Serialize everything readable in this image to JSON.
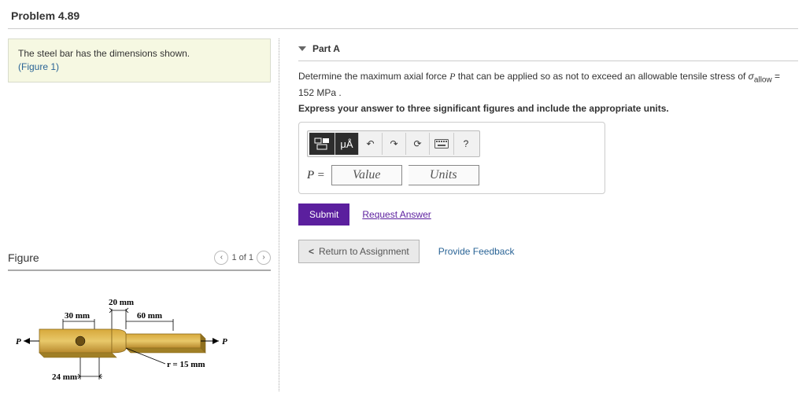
{
  "title": "Problem 4.89",
  "context": {
    "text": "The steel bar has the dimensions shown.",
    "figure_link": "(Figure 1)"
  },
  "part": {
    "header": "Part A",
    "question_prefix": "Determine the maximum axial force ",
    "question_var": "P",
    "question_mid": " that can be applied so as not to exceed an allowable tensile stress of ",
    "sigma_label": "σ",
    "sigma_sub": "allow",
    "sigma_eq": " = 152 ",
    "sigma_units": "MPa",
    "question_end": " .",
    "instructions": "Express your answer to three significant figures and include the appropriate units.",
    "var_label": "P =",
    "value_placeholder": "Value",
    "units_placeholder": "Units",
    "toolbar": {
      "templates": "▢/▢",
      "units_mode": "μÅ",
      "undo": "↶",
      "redo": "↷",
      "reset": "⟳",
      "keyboard": "⌨",
      "help": "?"
    },
    "submit": "Submit",
    "request_answer": "Request Answer"
  },
  "nav": {
    "return": "Return to Assignment",
    "feedback": "Provide Feedback"
  },
  "figure_panel": {
    "title": "Figure",
    "pager": "1 of 1",
    "prev": "‹",
    "next": "›"
  },
  "figure": {
    "P_left": "P",
    "P_right": "P",
    "dim_top": "20 mm",
    "dim_upper_left": "30 mm",
    "dim_upper_right": "60 mm",
    "dim_radius": "r = 15 mm",
    "dim_bottom": "24 mm"
  }
}
